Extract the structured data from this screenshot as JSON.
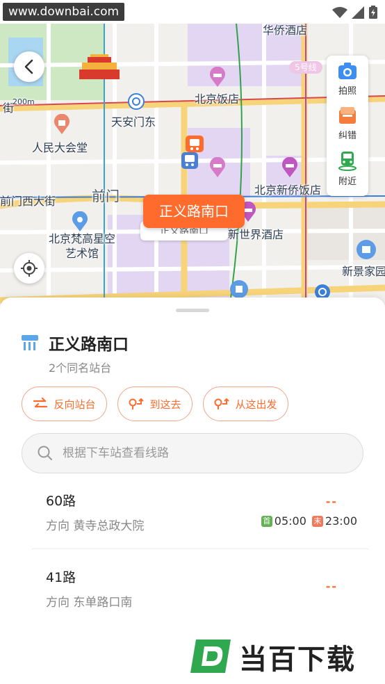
{
  "status_bar": {
    "watermark": "www.downbai.com"
  },
  "map": {
    "labels": {
      "tiananmen_east": "天安门东",
      "great_hall": "人民大会堂",
      "qianmen": "前门",
      "qianmen_west": "前门西大街",
      "beijing_hotel": "北京饭店",
      "xinqiao_hotel": "北京新侨饭店",
      "new_world_hotel": "北京新世界酒店",
      "fangao_art": "北京梵高星空艺术馆",
      "xinjing_home": "新景家园",
      "line5": "5号线",
      "scale": "200m",
      "top_hotel": "华侨酒店",
      "top_left_road": "街"
    },
    "side_tools": [
      {
        "label": "拍照",
        "icon": "camera-icon"
      },
      {
        "label": "纠错",
        "icon": "report-icon"
      },
      {
        "label": "附近",
        "icon": "nearby-bus-icon"
      }
    ],
    "callout": {
      "label": "正义路南口",
      "under_label": "正义路南口"
    }
  },
  "sheet": {
    "stop_name": "正义路南口",
    "stop_sub": "2个同名站台",
    "actions": [
      {
        "label": "反向站台",
        "icon": "swap-icon"
      },
      {
        "label": "到这去",
        "icon": "route-to-icon"
      },
      {
        "label": "从这出发",
        "icon": "route-from-icon"
      }
    ],
    "search_placeholder": "根据下车站查看线路",
    "routes": [
      {
        "number": "60路",
        "direction": "方向 黄寺总政大院",
        "status": "--",
        "first_tag": "首",
        "first_time": "05:00",
        "last_tag": "末",
        "last_time": "23:00"
      },
      {
        "number": "41路",
        "direction": "方向 东单路口南",
        "status": "--"
      }
    ],
    "brand": "当百下载"
  },
  "colors": {
    "accent": "#ff6b2c",
    "accent_border": "#f2a58a",
    "brand_green": "#2fa84f"
  }
}
